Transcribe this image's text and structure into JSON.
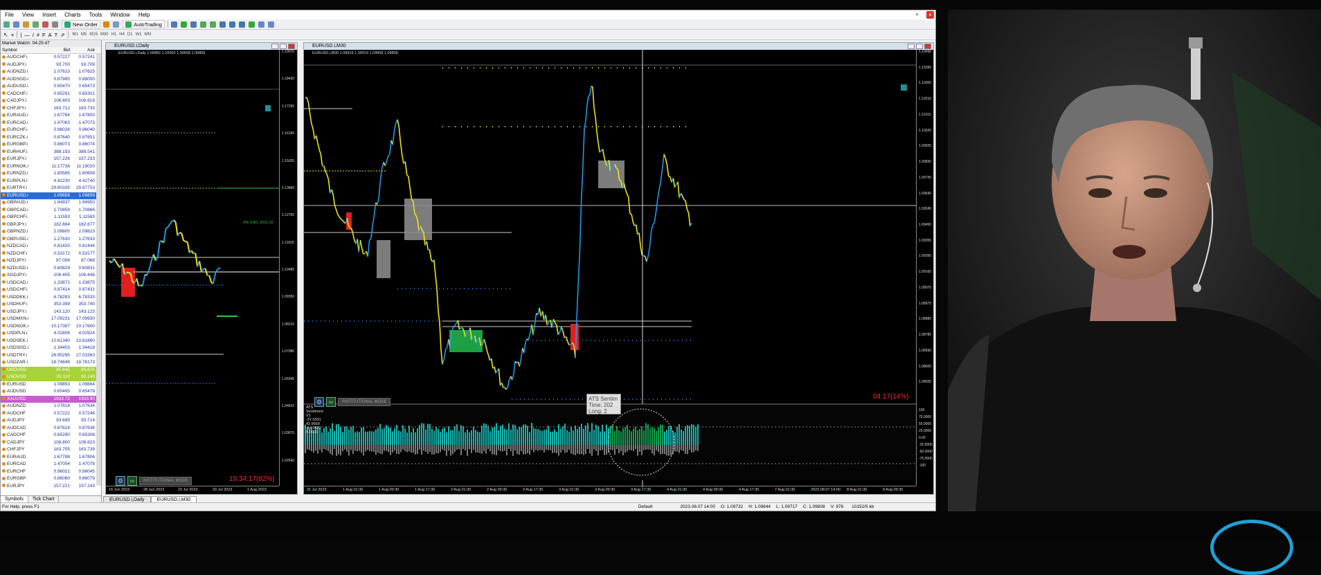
{
  "menu": [
    "File",
    "View",
    "Insert",
    "Charts",
    "Tools",
    "Window",
    "Help"
  ],
  "toolbar": {
    "new_order": "New Order",
    "autotrading": "AutoTrading",
    "timeframes": [
      "M1",
      "M5",
      "M15",
      "M30",
      "H1",
      "H4",
      "D1",
      "W1",
      "MN"
    ]
  },
  "market_watch": {
    "title": "Market Watch: 04:25:47",
    "col_symbol": "Symbol",
    "col_bid": "Bid",
    "col_ask": "Ask",
    "rows": [
      {
        "s": "AUDCHF.i",
        "b": "0.57227",
        "a": "0.57241"
      },
      {
        "s": "AUDJPY.i",
        "b": "93.700",
        "a": "93.709"
      },
      {
        "s": "AUDNZD.i",
        "b": "1.07623",
        "a": "1.07625"
      },
      {
        "s": "AUDSGD.i",
        "b": "0.87985",
        "a": "0.88000"
      },
      {
        "s": "AUDUSD.i",
        "b": "0.65470",
        "a": "0.65473"
      },
      {
        "s": "CADCHF.i",
        "b": "0.65291",
        "a": "0.65301"
      },
      {
        "s": "CADJPY.i",
        "b": "106.803",
        "a": "106.819"
      },
      {
        "s": "CHFJPY.i",
        "b": "163.712",
        "a": "163.733"
      },
      {
        "s": "EURAUD.i",
        "b": "1.67784",
        "a": "1.67800"
      },
      {
        "s": "EURCAD.i",
        "b": "1.47063",
        "a": "1.47073"
      },
      {
        "s": "EURCHF.i",
        "b": "0.96026",
        "a": "0.96040"
      },
      {
        "s": "EURCZK.i",
        "b": "0.87640",
        "a": "0.87651"
      },
      {
        "s": "EURGBP.i",
        "b": "0.86073",
        "a": "0.86074"
      },
      {
        "s": "EURHUF.i",
        "b": "388.193",
        "a": "388.541"
      },
      {
        "s": "EURJPY.i",
        "b": "157.226",
        "a": "157.233"
      },
      {
        "s": "EURNOK.i",
        "b": "11.17736",
        "a": "11.19020"
      },
      {
        "s": "EURNZD.i",
        "b": "1.80585",
        "a": "1.80608"
      },
      {
        "s": "EURPLN.i",
        "b": "4.42230",
        "a": "4.42740"
      },
      {
        "s": "EURTRY.i",
        "b": "29.60335",
        "a": "29.67753"
      },
      {
        "s": "EURUSD.i",
        "b": "1.09858",
        "a": "1.09859",
        "hl": "blue"
      },
      {
        "s": "GBPAUD.i",
        "b": "1.94937",
        "a": "1.94950"
      },
      {
        "s": "GBPCAD.i",
        "b": "1.70859",
        "a": "1.70866"
      },
      {
        "s": "GBPCHF.i",
        "b": "1.11593",
        "a": "1.11583"
      },
      {
        "s": "GBPJPY.i",
        "b": "182.664",
        "a": "182.677"
      },
      {
        "s": "GBPNZD.i",
        "b": "2.09800",
        "a": "2.09823"
      },
      {
        "s": "GBPUSD.i",
        "b": "1.27630",
        "a": "1.27633"
      },
      {
        "s": "NZDCAD.i",
        "b": "0.81420",
        "a": "0.81444"
      },
      {
        "s": "NZDCHF.i",
        "b": "0.53172",
        "a": "0.53177"
      },
      {
        "s": "NZDJPY.i",
        "b": "87.056",
        "a": "87.068"
      },
      {
        "s": "NZDUSD.i",
        "b": "0.60829",
        "a": "0.60831"
      },
      {
        "s": "SGDJPY.i",
        "b": "106.405",
        "a": "106.446"
      },
      {
        "s": "USDCAD.i",
        "b": "1.33872",
        "a": "1.33875"
      },
      {
        "s": "USDCHF.i",
        "b": "0.87414",
        "a": "0.87431"
      },
      {
        "s": "USDDKK.i",
        "b": "6.78283",
        "a": "6.78333"
      },
      {
        "s": "USDHUF.i",
        "b": "353.399",
        "a": "353.740"
      },
      {
        "s": "USDJPY.i",
        "b": "143.120",
        "a": "143.123"
      },
      {
        "s": "USDMXN.i",
        "b": "17.09231",
        "a": "17.09930"
      },
      {
        "s": "USDNOK.i",
        "b": "10.17387",
        "a": "10.17600"
      },
      {
        "s": "USDPLN.i",
        "b": "4.02806",
        "a": "4.02924"
      },
      {
        "s": "USDSEK.i",
        "b": "10.61340",
        "a": "10.61860"
      },
      {
        "s": "USDSGD.i",
        "b": "1.34403",
        "a": "1.34418"
      },
      {
        "s": "USDTRY.i",
        "b": "26.95295",
        "a": "27.01563"
      },
      {
        "s": "USDZAR.i",
        "b": "18.74649",
        "a": "18.76173"
      },
      {
        "s": "UKOUSD",
        "b": "85.645",
        "a": "85.675",
        "hl": "green"
      },
      {
        "s": "USOUSD",
        "b": "82.110",
        "a": "82.140",
        "hl": "green"
      },
      {
        "s": "EURUSD",
        "b": "1.09853",
        "a": "1.09864"
      },
      {
        "s": "AUDUSD",
        "b": "0.65465",
        "a": "0.65478"
      },
      {
        "s": "XAUUSD",
        "b": "1933.72",
        "a": "1933.90",
        "hl": "magenta"
      },
      {
        "s": "AUDNZD",
        "b": "1.07618",
        "a": "1.07634"
      },
      {
        "s": "AUDCHF",
        "b": "0.57222",
        "a": "0.57246"
      },
      {
        "s": "AUDJPY",
        "b": "93.695",
        "a": "93.714"
      },
      {
        "s": "AUDCAD",
        "b": "0.87618",
        "a": "0.87636"
      },
      {
        "s": "CADCHF",
        "b": "0.65280",
        "a": "0.65308"
      },
      {
        "s": "CADJPY",
        "b": "106.800",
        "a": "106.823"
      },
      {
        "s": "CHFJPY",
        "b": "163.705",
        "a": "163.739"
      },
      {
        "s": "EURAUD",
        "b": "1.67788",
        "a": "1.67806"
      },
      {
        "s": "EURCAD",
        "b": "1.47054",
        "a": "1.47078"
      },
      {
        "s": "EURCHF",
        "b": "0.96021",
        "a": "0.96045"
      },
      {
        "s": "EURGBP",
        "b": "0.86060",
        "a": "0.86079"
      },
      {
        "s": "EURJPY",
        "b": "157.221",
        "a": "157.243"
      }
    ],
    "tabs": [
      "Symbols",
      "Tick Chart"
    ]
  },
  "chart_daily": {
    "title": "EURUSD.i,Daily",
    "info": "EURUSD.i,Daily  1.09982 1.10050 1.09658 1.09858",
    "timer": "19:34:17(82%)",
    "usd_label": "2% USD: 2011.03",
    "prices": [
      "1.19570",
      "1.18430",
      "1.17295",
      "1.16165",
      "1.15025",
      "1.13890",
      "1.12755",
      "1.11620",
      "1.10485",
      "1.09350",
      "1.08215",
      "1.07080",
      "1.05945",
      "1.04810",
      "1.03675",
      "1.02540"
    ],
    "dates": [
      "16 Jun 2023",
      "28 Jun 2023",
      "10 Jul 2023",
      "20 Jul 2023",
      "1 Aug 2023"
    ]
  },
  "chart_m30": {
    "title": "EURUSD.i,M30",
    "info": "EURUSD.i,M30  1.09919 1.09919 1.09858 1.09858",
    "timer": "04:17(14%)",
    "current_price": "1.09858",
    "prices": [
      "1.10490",
      "1.10395",
      "1.10300",
      "1.10210",
      "1.10115",
      "1.10020",
      "1.09925",
      "1.09830",
      "1.09735",
      "1.09640",
      "1.09545",
      "1.09450",
      "1.09355",
      "1.09260",
      "1.09165",
      "1.09070",
      "1.08975",
      "1.08880",
      "1.08785",
      "1.08690",
      "1.08600",
      "1.08505"
    ],
    "indicator_title": "ATS Sentiment V1 -37.0331 42.9669 -14.0661 0.0000",
    "ind_scale": [
      "100",
      "75.0000",
      "50.0000",
      "25.0000",
      "0.00",
      "-25.0000",
      "-50.0000",
      "-75.0000",
      "-100"
    ],
    "dates": [
      "31 Jul 2023",
      "1 Aug 01:30",
      "1 Aug 09:30",
      "1 Aug 17:30",
      "2 Aug 01:30",
      "2 Aug 09:30",
      "2 Aug 17:30",
      "3 Aug 01:30",
      "3 Aug 09:30",
      "3 Aug 17:30",
      "4 Aug 01:30",
      "4 Aug 09:30",
      "4 Aug 17:30",
      "7 Aug 01:30",
      "2023.08.07 14:00",
      "8 Aug 01:30",
      "8 Aug 09:30"
    ],
    "tooltip": [
      "ATS Sentim",
      "Time: 202",
      "Long: 2"
    ]
  },
  "institutional_mode": "INSTITUTIONAL MODE",
  "doc_tabs": [
    "EURUSD.i,Daily",
    "EURUSD.i,M30"
  ],
  "status": {
    "help": "For Help, press F1",
    "profile": "Default",
    "time": "2023.08.07 14:00",
    "open": "O: 1.09732",
    "high": "H: 1.09844",
    "low": "L: 1.09717",
    "close": "C: 1.09808",
    "volume": "V: 976",
    "conn": "10152/5 kb"
  },
  "colors": {
    "bull": "#1e9be8",
    "bear": "#f2e21a",
    "zone_gray": "#8a8a8a",
    "zone_green": "#1da043",
    "zone_red": "#e02020",
    "teal": "#18b5b0"
  }
}
